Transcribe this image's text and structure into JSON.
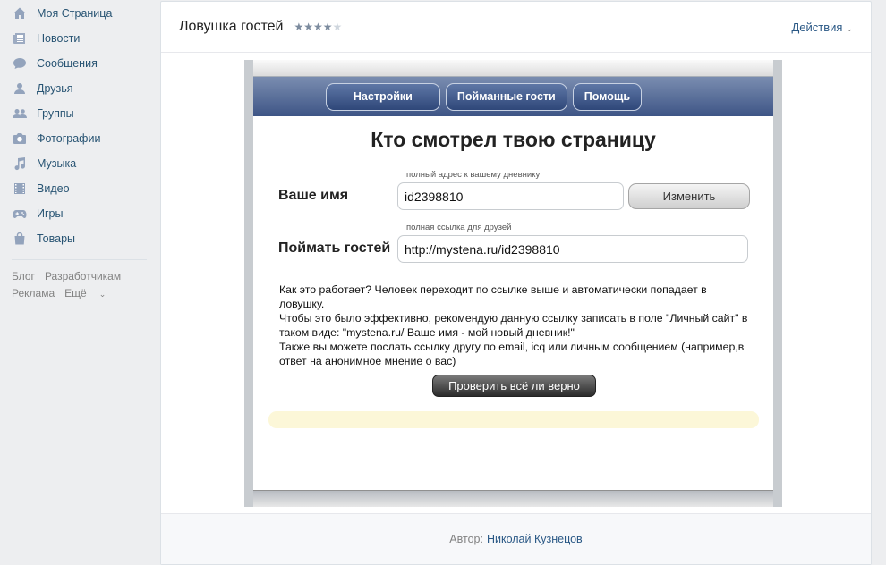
{
  "sidebar": {
    "items": [
      {
        "label": "Моя Страница",
        "icon": "home-icon"
      },
      {
        "label": "Новости",
        "icon": "news-icon"
      },
      {
        "label": "Сообщения",
        "icon": "messages-icon"
      },
      {
        "label": "Друзья",
        "icon": "friends-icon"
      },
      {
        "label": "Группы",
        "icon": "groups-icon"
      },
      {
        "label": "Фотографии",
        "icon": "camera-icon"
      },
      {
        "label": "Музыка",
        "icon": "music-icon"
      },
      {
        "label": "Видео",
        "icon": "video-icon"
      },
      {
        "label": "Игры",
        "icon": "gamepad-icon"
      },
      {
        "label": "Товары",
        "icon": "shopping-bag-icon"
      }
    ],
    "footer_links": [
      "Блог",
      "Разработчикам",
      "Реклама",
      "Ещё"
    ]
  },
  "header": {
    "title": "Ловушка гостей",
    "rating": 4,
    "rating_max": 5,
    "actions_label": "Действия"
  },
  "app": {
    "tabs": [
      "Настройки",
      "Пойманные гости",
      "Помощь"
    ],
    "heading": "Кто смотрел твою страницу",
    "name_label": "Ваше имя",
    "name_hint": "полный адрес к вашему дневнику",
    "name_value": "id2398810",
    "change_button": "Изменить",
    "catch_label": "Поймать гостей",
    "catch_hint": "полная ссылка для друзей",
    "catch_value": "http://mystena.ru/id2398810",
    "description": [
      "Как это работает? Человек переходит по ссылке выше и автоматически попадает в ловушку.",
      "Чтобы это было эффективно, рекомендую данную ссылку записать в поле \"Личный сайт\" в таком виде: \"mystena.ru/ Ваше имя - мой новый дневник!\"",
      "Также вы можете послать ссылку другу по email, icq или личным сообщением (например,в ответ на анонимное мнение о вас)"
    ],
    "check_button": "Проверить всё ли верно"
  },
  "footer": {
    "author_label": "Автор:",
    "author_name": "Николай Кузнецов"
  },
  "colors": {
    "link": "#2a5885",
    "sidebar_text": "#285473",
    "navbar": "#3e5586",
    "result_box": "#fcf7d8"
  }
}
